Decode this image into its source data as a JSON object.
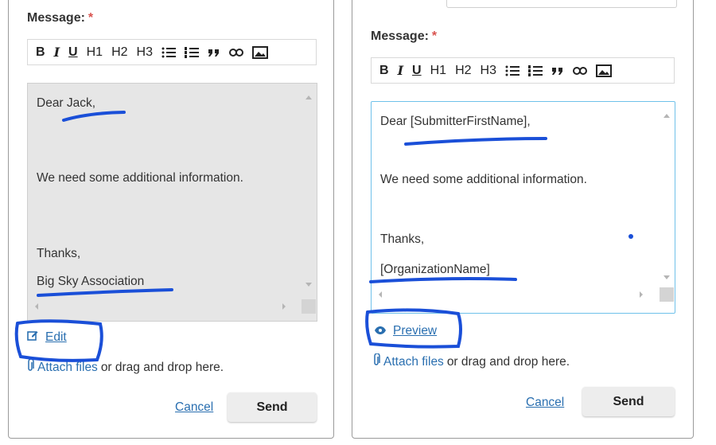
{
  "left_panel": {
    "message_label": "Message:",
    "required_mark": "*",
    "toolbar": [
      "B",
      "I",
      "U",
      "H1",
      "H2",
      "H3",
      "bullet-list-icon",
      "numbered-list-icon",
      "quote-icon",
      "link-icon",
      "image-icon"
    ],
    "editor_lines": [
      "Dear Jack,",
      "We need some additional information.",
      "Thanks,",
      "Big Sky Association"
    ],
    "mode_toggle": "Edit",
    "attach_link": "Attach files",
    "attach_text": "or drag and drop here.",
    "cancel": "Cancel",
    "send": "Send"
  },
  "right_panel": {
    "message_label": "Message:",
    "required_mark": "*",
    "toolbar": [
      "B",
      "I",
      "U",
      "H1",
      "H2",
      "H3",
      "bullet-list-icon",
      "numbered-list-icon",
      "quote-icon",
      "link-icon",
      "image-icon"
    ],
    "editor_lines": [
      "Dear [SubmitterFirstName],",
      "We need some additional information.",
      "Thanks,",
      "[OrganizationName]"
    ],
    "mode_toggle": "Preview",
    "attach_link": "Attach files",
    "attach_text": "or drag and drop here.",
    "cancel": "Cancel",
    "send": "Send"
  },
  "colors": {
    "accent_link": "#2a6fb0",
    "required": "#d9534f",
    "annotation_ink": "#1a4fd8",
    "editor_focus_border": "#6fc1ea",
    "editor_readonly_bg": "#e6e6e6"
  }
}
